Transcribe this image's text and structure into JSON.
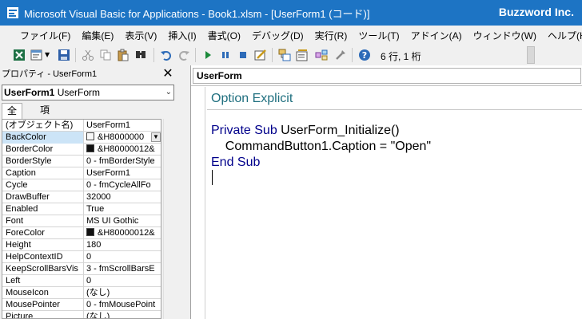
{
  "window": {
    "title": "Microsoft Visual Basic for Applications - Book1.xlsm - [UserForm1 (コード)]",
    "brand": "Buzzword Inc."
  },
  "menu": {
    "items": [
      "ファイル(F)",
      "編集(E)",
      "表示(V)",
      "挿入(I)",
      "書式(O)",
      "デバッグ(D)",
      "実行(R)",
      "ツール(T)",
      "アドイン(A)",
      "ウィンドウ(W)",
      "ヘルプ(H)"
    ]
  },
  "toolbar": {
    "status": "6 行, 1 桁",
    "icons": [
      "excel-icon",
      "insert-form-icon",
      "save-icon",
      "cut-icon",
      "copy-icon",
      "paste-icon",
      "find-icon",
      "undo-icon",
      "redo-icon",
      "run-icon",
      "break-icon",
      "reset-icon",
      "design-mode-icon",
      "project-explorer-icon",
      "properties-window-icon",
      "object-browser-icon",
      "toolbox-icon",
      "help-icon"
    ]
  },
  "properties": {
    "title": "プロパティ - UserForm1",
    "object_name": "UserForm1",
    "object_type": "UserForm",
    "tabs": [
      "全体",
      "項目別"
    ],
    "rows": [
      {
        "name": "(オブジェクト名)",
        "value": "UserForm1"
      },
      {
        "name": "BackColor",
        "value": "&H8000000"
      },
      {
        "name": "BorderColor",
        "value": "&H80000012&"
      },
      {
        "name": "BorderStyle",
        "value": "0 - fmBorderStyle"
      },
      {
        "name": "Caption",
        "value": "UserForm1"
      },
      {
        "name": "Cycle",
        "value": "0 - fmCycleAllFo"
      },
      {
        "name": "DrawBuffer",
        "value": "32000"
      },
      {
        "name": "Enabled",
        "value": "True"
      },
      {
        "name": "Font",
        "value": "MS UI Gothic"
      },
      {
        "name": "ForeColor",
        "value": "&H80000012&"
      },
      {
        "name": "Height",
        "value": "180"
      },
      {
        "name": "HelpContextID",
        "value": "0"
      },
      {
        "name": "KeepScrollBarsVis",
        "value": "3 - fmScrollBarsE"
      },
      {
        "name": "Left",
        "value": "0"
      },
      {
        "name": "MouseIcon",
        "value": "(なし)"
      },
      {
        "name": "MousePointer",
        "value": "0 - fmMousePoint"
      },
      {
        "name": "Picture",
        "value": "(なし)"
      }
    ],
    "colors": {
      "backcolor_swatch": "#f8f8f8",
      "dark_swatch": "#111111"
    }
  },
  "code": {
    "object_combo": "UserForm",
    "line1": "Option Explicit",
    "line3_kw": "Private Sub",
    "line3_rest": " UserForm_Initialize()",
    "line4": "    CommandButton1.Caption = \"Open\"",
    "line5": "End Sub"
  },
  "colors": {
    "titlebar": "#1d74c4",
    "keyword": "#00008b",
    "green_text": "#1f6f7f"
  }
}
